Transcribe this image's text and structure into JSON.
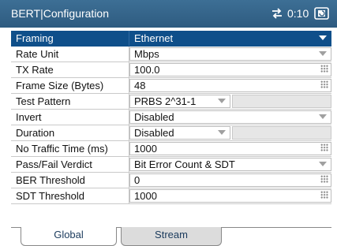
{
  "header": {
    "title": "BERT|Configuration",
    "time": "0:10",
    "icons": [
      "swap-arrows-icon",
      "battery-icon"
    ]
  },
  "config": {
    "rows": [
      {
        "label": "Framing",
        "value": "Ethernet",
        "control": "dropdown",
        "selected": true
      },
      {
        "label": "Rate Unit",
        "value": "Mbps",
        "control": "dropdown"
      },
      {
        "label": "TX Rate",
        "value": "100.0",
        "control": "numeric"
      },
      {
        "label": "Frame Size (Bytes)",
        "value": "48",
        "control": "numeric"
      },
      {
        "label": "Test Pattern",
        "value": "PRBS 2^31-1",
        "control": "dropdown-narrow"
      },
      {
        "label": "Invert",
        "value": "Disabled",
        "control": "dropdown"
      },
      {
        "label": "Duration",
        "value": "Disabled",
        "control": "dropdown-narrow"
      },
      {
        "label": "No Traffic Time (ms)",
        "value": "1000",
        "control": "numeric"
      },
      {
        "label": "Pass/Fail Verdict",
        "value": "Bit Error Count & SDT",
        "control": "dropdown"
      },
      {
        "label": "BER Threshold",
        "value": "0",
        "control": "numeric"
      },
      {
        "label": "SDT Threshold",
        "value": "1000",
        "control": "numeric"
      }
    ]
  },
  "tabs": [
    {
      "label": "Global",
      "active": true
    },
    {
      "label": "Stream",
      "active": false
    }
  ],
  "colors": {
    "title_bar": "#2e5b80",
    "selected_row": "#0f4f8a"
  }
}
